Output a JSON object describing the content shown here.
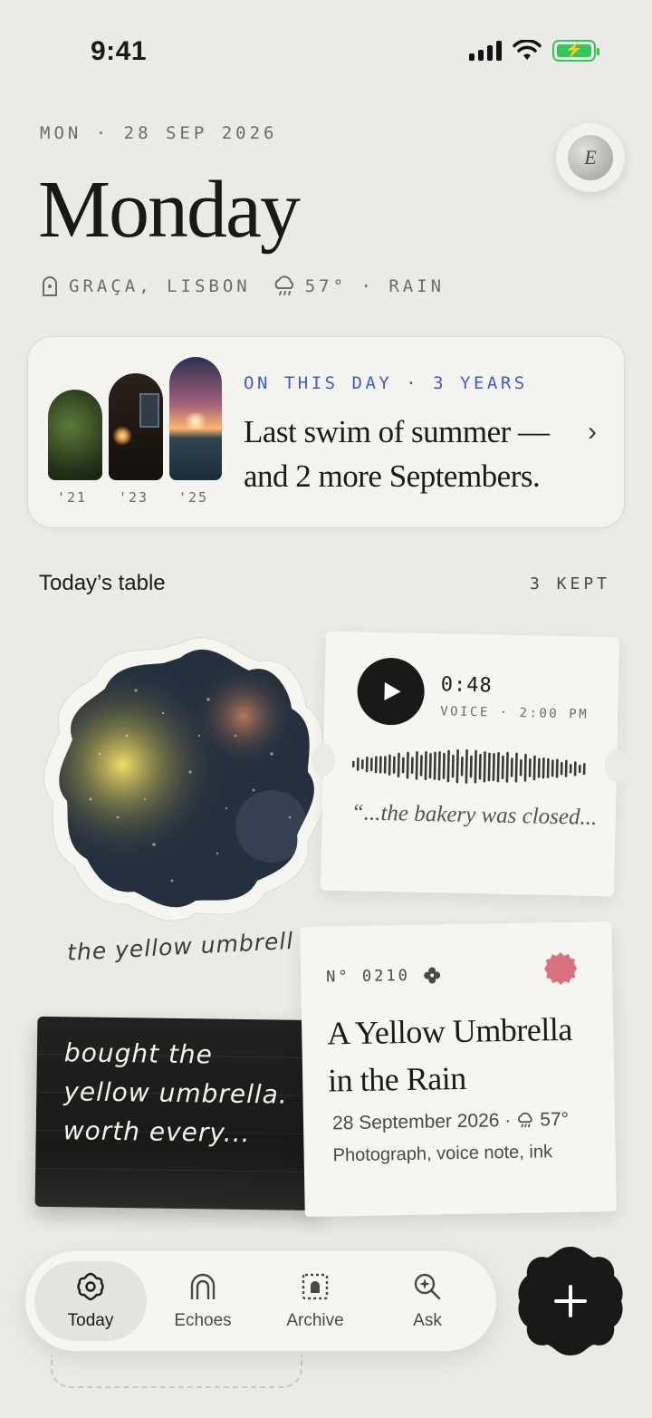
{
  "status": {
    "time": "9:41"
  },
  "header": {
    "date_line": "MON · 28 SEP 2026",
    "day": "Monday",
    "location": "GRAÇA, LISBON",
    "weather": "57° · RAIN",
    "avatar_initial": "E"
  },
  "on_this_day": {
    "kicker": "ON THIS DAY · 3 YEARS",
    "text": "Last swim of summer — and 2 more Septembers.",
    "years": [
      "'21",
      "'23",
      "'25"
    ]
  },
  "section": {
    "title": "Today’s table",
    "count": "3 KEPT"
  },
  "photo": {
    "caption": "the yellow umbrell"
  },
  "voice": {
    "duration": "0:48",
    "meta": "VOICE · 2:00 PM",
    "quote": "“...the bakery was closed..."
  },
  "ink": {
    "lines": [
      "bought the",
      "yellow umbrella.",
      "worth every..."
    ]
  },
  "entry": {
    "number": "N° 0210",
    "title": "A Yellow Umbrella in the Rain",
    "date": "28 September 2026 ·",
    "temp": "57°",
    "kinds": "Photograph, voice note, ink"
  },
  "tabs": [
    {
      "label": "Today",
      "icon": "flower-icon"
    },
    {
      "label": "Echoes",
      "icon": "arch-icon"
    },
    {
      "label": "Archive",
      "icon": "archive-icon"
    },
    {
      "label": "Ask",
      "icon": "search-sparkle-icon"
    }
  ],
  "colors": {
    "accent_blue": "#3d5fc4",
    "battery": "#34c759",
    "seal": "#d9707e"
  }
}
